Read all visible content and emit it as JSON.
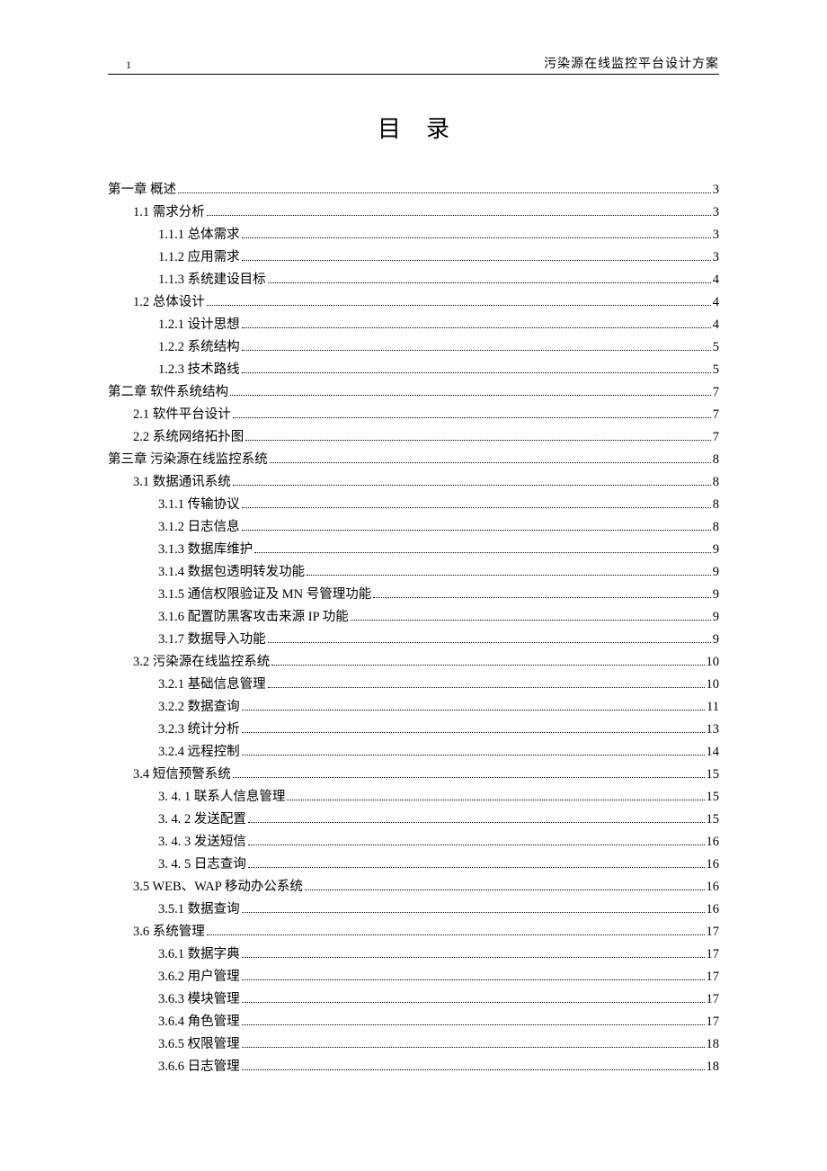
{
  "header": {
    "page_number": "1",
    "doc_title": "污染源在线监控平台设计方案"
  },
  "title": "目录",
  "toc": [
    {
      "level": 1,
      "label": "第一章  概述",
      "page": "3"
    },
    {
      "level": 2,
      "label": "1.1  需求分析",
      "page": "3"
    },
    {
      "level": 3,
      "label": "1.1.1  总体需求",
      "page": "3"
    },
    {
      "level": 3,
      "label": "1.1.2  应用需求",
      "page": "3"
    },
    {
      "level": 3,
      "label": "1.1.3  系统建设目标",
      "page": "4"
    },
    {
      "level": 2,
      "label": "1.2  总体设计",
      "page": "4"
    },
    {
      "level": 3,
      "label": "1.2.1  设计思想",
      "page": "4"
    },
    {
      "level": 3,
      "label": "1.2.2  系统结构",
      "page": "5"
    },
    {
      "level": 3,
      "label": "1.2.3  技术路线",
      "page": "5"
    },
    {
      "level": 1,
      "label": "第二章  软件系统结构",
      "page": "7"
    },
    {
      "level": 2,
      "label": "2.1  软件平台设计",
      "page": "7"
    },
    {
      "level": 2,
      "label": "2.2  系统网络拓扑图",
      "page": "7"
    },
    {
      "level": 1,
      "label": "第三章  污染源在线监控系统",
      "page": "8"
    },
    {
      "level": 2,
      "label": "3.1  数据通讯系统",
      "page": "8"
    },
    {
      "level": 3,
      "label": "3.1.1  传输协议",
      "page": "8"
    },
    {
      "level": 3,
      "label": "3.1.2  日志信息",
      "page": "8"
    },
    {
      "level": 3,
      "label": "3.1.3  数据库维护",
      "page": "9"
    },
    {
      "level": 3,
      "label": "3.1.4  数据包透明转发功能",
      "page": "9"
    },
    {
      "level": 3,
      "label": "3.1.5  通信权限验证及 MN 号管理功能",
      "page": "9"
    },
    {
      "level": 3,
      "label": "3.1.6  配置防黑客攻击来源 IP 功能",
      "page": "9"
    },
    {
      "level": 3,
      "label": "3.1.7  数据导入功能",
      "page": "9"
    },
    {
      "level": 2,
      "label": "3.2  污染源在线监控系统",
      "page": "10"
    },
    {
      "level": 3,
      "label": "3.2.1  基础信息管理",
      "page": "10"
    },
    {
      "level": 3,
      "label": "3.2.2  数据查询",
      "page": "11"
    },
    {
      "level": 3,
      "label": "3.2.3  统计分析",
      "page": "13"
    },
    {
      "level": 3,
      "label": "3.2.4  远程控制",
      "page": "14"
    },
    {
      "level": 2,
      "label": "3.4  短信预警系统",
      "page": "15"
    },
    {
      "level": 3,
      "label": "3. 4. 1    联系人信息管理",
      "page": "15"
    },
    {
      "level": 3,
      "label": "3. 4. 2    发送配置",
      "page": "15"
    },
    {
      "level": 3,
      "label": "3. 4. 3    发送短信",
      "page": "16"
    },
    {
      "level": 3,
      "label": "3. 4. 5    日志查询",
      "page": "16"
    },
    {
      "level": 2,
      "label": "3.5 WEB、WAP 移动办公系统",
      "page": "16"
    },
    {
      "level": 3,
      "label": "3.5.1  数据查询",
      "page": "16"
    },
    {
      "level": 2,
      "label": "3.6  系统管理",
      "page": "17"
    },
    {
      "level": 3,
      "label": "3.6.1  数据字典",
      "page": "17"
    },
    {
      "level": 3,
      "label": "3.6.2  用户管理",
      "page": "17"
    },
    {
      "level": 3,
      "label": "3.6.3  模块管理",
      "page": "17"
    },
    {
      "level": 3,
      "label": "3.6.4  角色管理",
      "page": "17"
    },
    {
      "level": 3,
      "label": "3.6.5  权限管理",
      "page": "18"
    },
    {
      "level": 3,
      "label": "3.6.6  日志管理",
      "page": "18"
    }
  ]
}
